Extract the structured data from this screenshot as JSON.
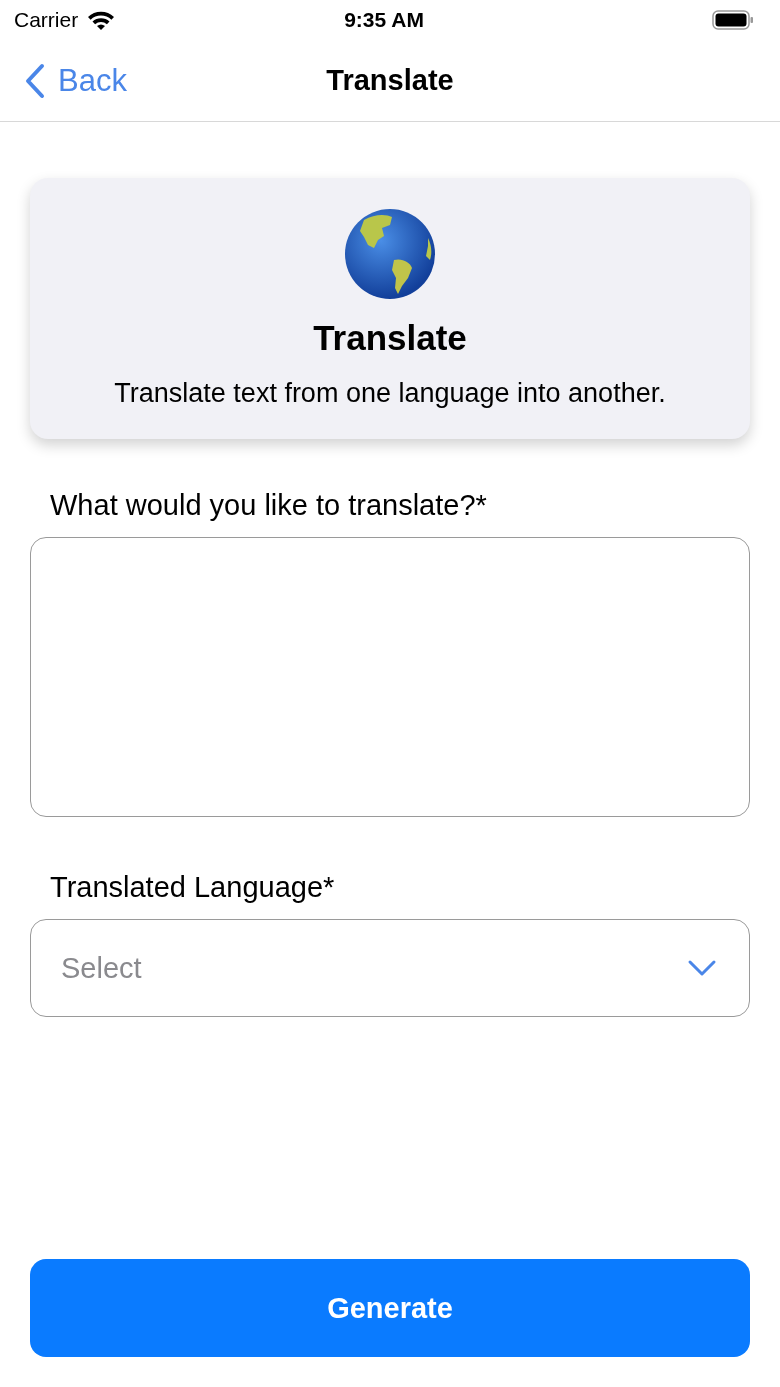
{
  "status_bar": {
    "carrier": "Carrier",
    "time": "9:35 AM"
  },
  "nav_bar": {
    "back": "Back",
    "title": "Translate"
  },
  "card": {
    "title": "Translate",
    "description": "Translate text from one language into another."
  },
  "fields": [
    {
      "kind": "textarea",
      "label": "What would you like to translate?*"
    },
    {
      "kind": "select",
      "label": "Translated Language*",
      "placeholder": "Select"
    }
  ],
  "button": "Generate"
}
